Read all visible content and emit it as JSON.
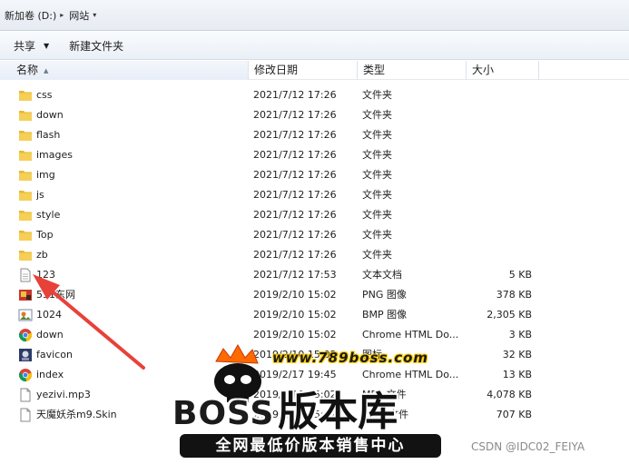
{
  "breadcrumb": {
    "drive": "新加卷 (D:)",
    "folder": "网站"
  },
  "toolbar": {
    "share_label": "共享",
    "new_folder_label": "新建文件夹"
  },
  "columns": {
    "name": "名称",
    "date": "修改日期",
    "type": "类型",
    "size": "大小"
  },
  "files": [
    {
      "name": "css",
      "date": "2021/7/12 17:26",
      "type": "文件夹",
      "size": "",
      "icon": "folder-icon"
    },
    {
      "name": "down",
      "date": "2021/7/12 17:26",
      "type": "文件夹",
      "size": "",
      "icon": "folder-icon"
    },
    {
      "name": "flash",
      "date": "2021/7/12 17:26",
      "type": "文件夹",
      "size": "",
      "icon": "folder-icon"
    },
    {
      "name": "images",
      "date": "2021/7/12 17:26",
      "type": "文件夹",
      "size": "",
      "icon": "folder-icon"
    },
    {
      "name": "img",
      "date": "2021/7/12 17:26",
      "type": "文件夹",
      "size": "",
      "icon": "folder-icon"
    },
    {
      "name": "js",
      "date": "2021/7/12 17:26",
      "type": "文件夹",
      "size": "",
      "icon": "folder-icon"
    },
    {
      "name": "style",
      "date": "2021/7/12 17:26",
      "type": "文件夹",
      "size": "",
      "icon": "folder-icon"
    },
    {
      "name": "Top",
      "date": "2021/7/12 17:26",
      "type": "文件夹",
      "size": "",
      "icon": "folder-icon"
    },
    {
      "name": "zb",
      "date": "2021/7/12 17:26",
      "type": "文件夹",
      "size": "",
      "icon": "folder-icon"
    },
    {
      "name": "123",
      "date": "2021/7/12 17:53",
      "type": "文本文档",
      "size": "5 KB",
      "icon": "text-file-icon"
    },
    {
      "name": "531东网",
      "date": "2019/2/10 15:02",
      "type": "PNG 图像",
      "size": "378 KB",
      "icon": "png-image-icon"
    },
    {
      "name": "1024",
      "date": "2019/2/10 15:02",
      "type": "BMP 图像",
      "size": "2,305 KB",
      "icon": "bmp-image-icon"
    },
    {
      "name": "down",
      "date": "2019/2/10 15:02",
      "type": "Chrome HTML Do...",
      "size": "3 KB",
      "icon": "chrome-icon"
    },
    {
      "name": "favicon",
      "date": "2019/2/10 15:02",
      "type": "图标",
      "size": "32 KB",
      "icon": "favicon-icon"
    },
    {
      "name": "index",
      "date": "2019/2/17 19:45",
      "type": "Chrome HTML Do...",
      "size": "13 KB",
      "icon": "chrome-icon"
    },
    {
      "name": "yezivi.mp3",
      "date": "2019/2/10 15:02",
      "type": "MP3 文件",
      "size": "4,078 KB",
      "icon": "generic-file-icon"
    },
    {
      "name": "天魔妖杀m9.Skin",
      "date": "2019/2/10 15:02",
      "type": "SKIN 文件",
      "size": "707 KB",
      "icon": "generic-file-icon"
    }
  ],
  "watermark": {
    "site": "www.789boss.com",
    "brand": "BOSS",
    "title": "版本库",
    "slogan": "全网最低价版本销售中心"
  },
  "credit": "CSDN @IDC02_FEIYA",
  "colors": {
    "folder": "#f2c744",
    "arrow": "#e8413a",
    "banner": "#121212",
    "crown": "#ff6a00"
  }
}
